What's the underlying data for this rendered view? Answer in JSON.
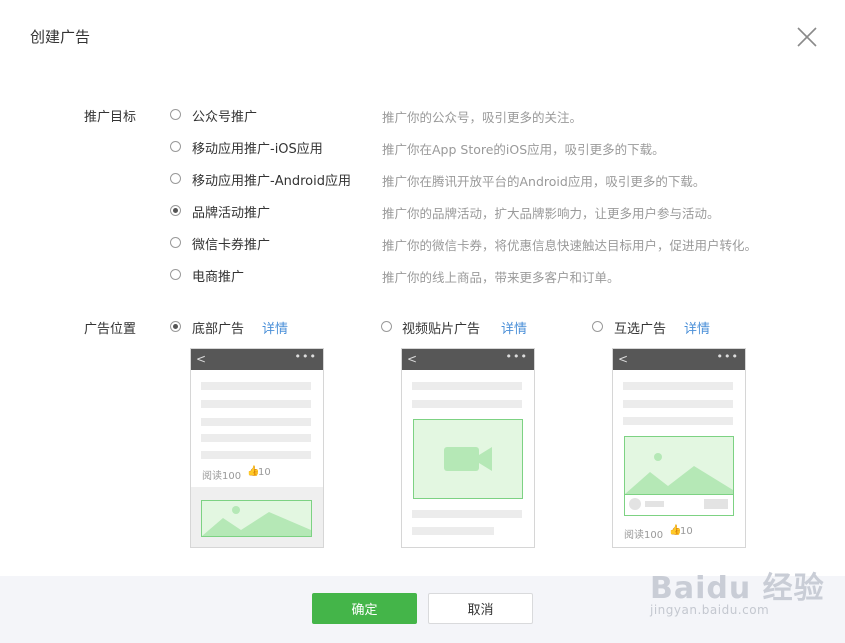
{
  "dialog": {
    "title": "创建广告"
  },
  "objective": {
    "label": "推广目标",
    "options": [
      {
        "label": "公众号推广",
        "desc": "推广你的公众号，吸引更多的关注。",
        "checked": false
      },
      {
        "label": "移动应用推广-iOS应用",
        "desc": "推广你在App Store的iOS应用，吸引更多的下载。",
        "checked": false
      },
      {
        "label": "移动应用推广-Android应用",
        "desc": "推广你在腾讯开放平台的Android应用，吸引更多的下载。",
        "checked": false
      },
      {
        "label": "品牌活动推广",
        "desc": "推广你的品牌活动，扩大品牌影响力，让更多用户参与活动。",
        "checked": true
      },
      {
        "label": "微信卡券推广",
        "desc": "推广你的微信卡券，将优惠信息快速触达目标用户，促进用户转化。",
        "checked": false
      },
      {
        "label": "电商推广",
        "desc": "推广你的线上商品，带来更多客户和订单。",
        "checked": false
      }
    ]
  },
  "placement": {
    "label": "广告位置",
    "detail_label": "详情",
    "options": [
      {
        "label": "底部广告",
        "checked": true,
        "reads": "阅读100",
        "likes": "10"
      },
      {
        "label": "视频贴片广告",
        "checked": false
      },
      {
        "label": "互选广告",
        "checked": false,
        "reads": "阅读100",
        "likes": "10"
      }
    ]
  },
  "footer": {
    "confirm": "确定",
    "cancel": "取消"
  },
  "watermark": {
    "brand": "Baidu 经验",
    "url": "jingyan.baidu.com"
  },
  "colors": {
    "primary": "#44b549",
    "link": "#4a8fd8",
    "illustration_fill": "#e3f7e1",
    "illustration_stroke": "#7dd283",
    "illustration_shape": "#b5e8b6"
  }
}
